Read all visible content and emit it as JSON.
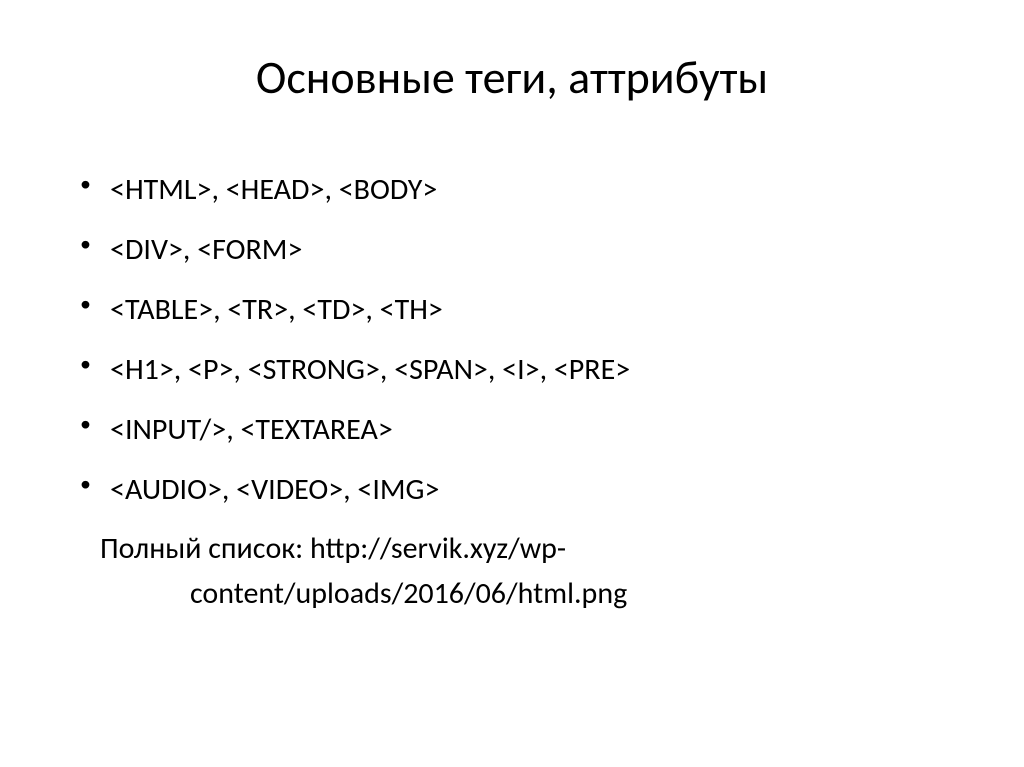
{
  "title": "Основные теги, аттрибуты",
  "bullets": [
    "<HTML>, <HEAD>, <BODY>",
    "<DIV>, <FORM>",
    "<TABLE>, <TR>, <TD>, <TH>",
    "<H1>, <P>, <STRONG>, <SPAN>, <I>, <PRE>",
    "<INPUT/>, <TEXTAREA>",
    "<AUDIO>, <VIDEO>, <IMG>"
  ],
  "footer_line1": "Полный список: http://servik.xyz/wp-",
  "footer_line2": "content/uploads/2016/06/html.png"
}
